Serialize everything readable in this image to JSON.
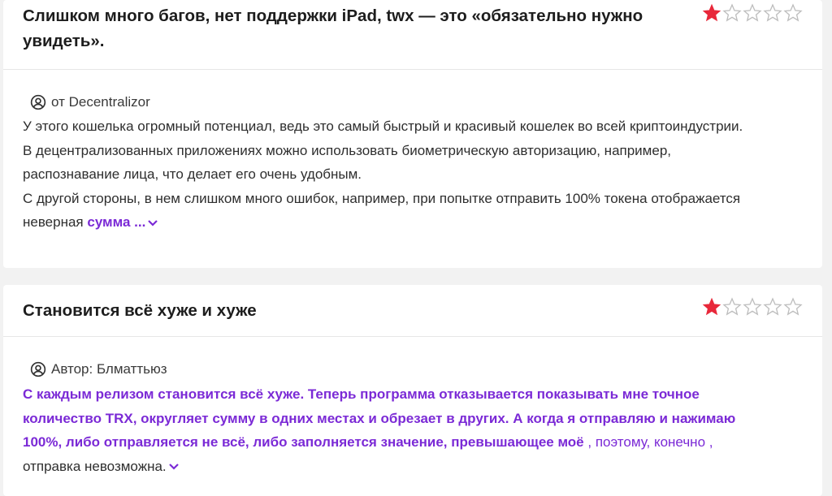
{
  "reviews": [
    {
      "title": "Слишком много багов, нет поддержки iPad, twx — это «обязательно нужно увидеть».",
      "rating": 1,
      "max_rating": 5,
      "author": "от Decentralizor",
      "body_lines": [
        "У этого кошелька огромный потенциал, ведь это самый быстрый и красивый кошелек во всей криптоиндустрии. В децентрализованных приложениях можно использовать биометрическую авторизацию, например, распознавание лица, что делает его очень удобным.",
        "С другой стороны, в нем слишком много ошибок, например, при попытке отправить 100% токена отображается неверная"
      ],
      "more_label": "сумма",
      "ellipsis": " ..."
    },
    {
      "title": "Становится всё хуже и хуже",
      "rating": 1,
      "max_rating": 5,
      "author": "Автор: Блматтьюз",
      "body_bold": "С каждым релизом становится всё хуже. Теперь программа отказывается показывать мне точное количество TRX, округляет сумму в одних местах и обрезает в других. А когда я отправляю и нажимаю 100%, либо отправляется не всё, либо заполняется значение, превышающее моё",
      "body_purple": " , поэтому, конечно ,",
      "body_tail": " отправка невозможна."
    }
  ],
  "colors": {
    "star_filled": "#e8283a",
    "star_empty": "#cfcfcf",
    "accent": "#7b2ad6"
  },
  "icons": {
    "author": "user-circle-icon",
    "expand": "chevron-down-icon",
    "rating": "star-icon"
  }
}
